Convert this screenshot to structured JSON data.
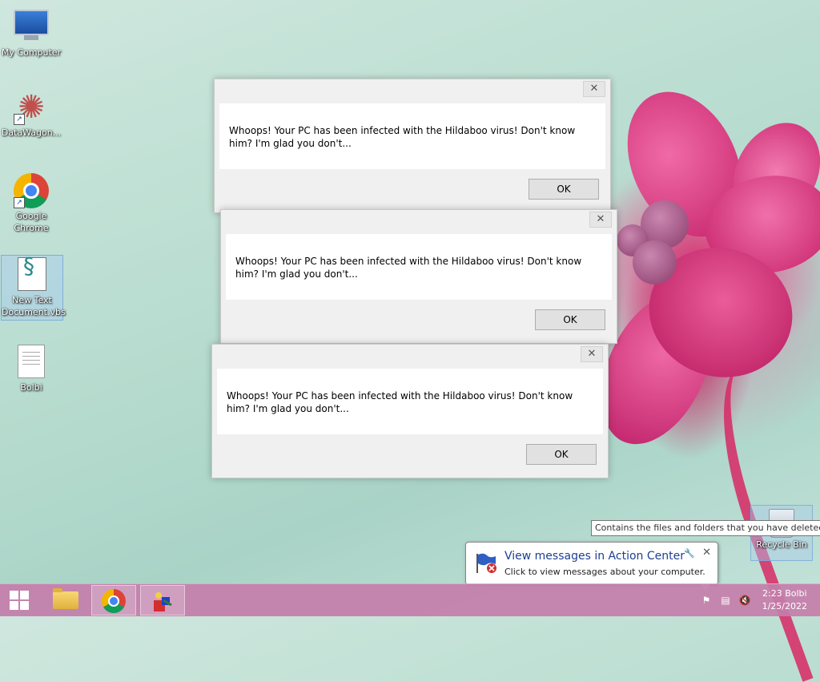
{
  "desktop": {
    "icons": [
      {
        "label": "My Computer"
      },
      {
        "label": "DataWagon..."
      },
      {
        "label": "Google Chrome"
      },
      {
        "label": "New Text Document.vbs"
      },
      {
        "label": "Bolbi"
      }
    ],
    "recycle_bin": {
      "label": "Recycle Bin"
    },
    "recycle_tooltip": "Contains the files and folders that you have deleted."
  },
  "dialogs": [
    {
      "message": "Whoops! Your PC has been infected with the Hildaboo virus! Don't know him? I'm glad you don't...",
      "ok_label": "OK",
      "close_label": "✕"
    },
    {
      "message": "Whoops! Your PC has been infected with the Hildaboo virus! Don't know him? I'm glad you don't...",
      "ok_label": "OK",
      "close_label": "✕"
    },
    {
      "message": "Whoops! Your PC has been infected with the Hildaboo virus! Don't know him? I'm glad you don't...",
      "ok_label": "OK",
      "close_label": "✕"
    }
  ],
  "action_center_balloon": {
    "title": "View messages in Action Center",
    "text": "Click to view messages about your computer.",
    "close_label": "✕"
  },
  "taskbar": {
    "pinned": [
      "file-explorer",
      "google-chrome",
      "app"
    ],
    "tray_icons": [
      "action-center-flag-icon",
      "network-icon",
      "volume-muted-icon"
    ],
    "clock": {
      "time": "2:23 Bolbi",
      "date": "1/25/2022"
    }
  },
  "colors": {
    "taskbar": "#c47eaa",
    "balloon_title": "#1c3f94",
    "desktop_bg": "#b7dccf",
    "flower": "#d8306f"
  }
}
